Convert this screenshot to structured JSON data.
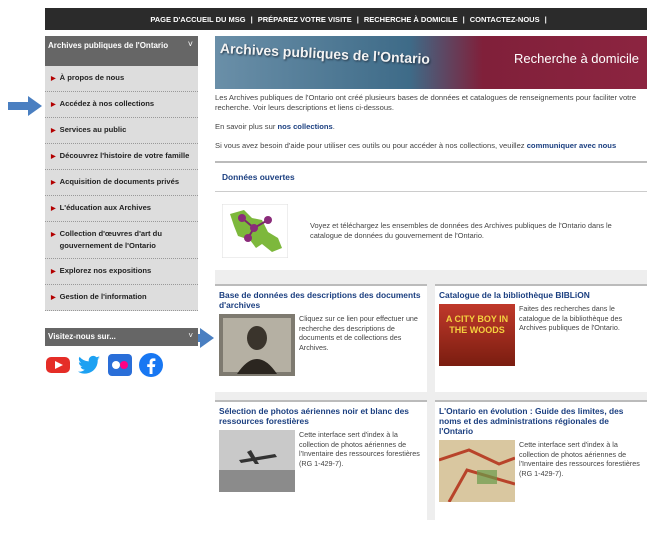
{
  "topnav": {
    "items": [
      "PAGE D'ACCUEIL DU MSG",
      "PRÉPAREZ VOTRE VISITE",
      "RECHERCHE À DOMICILE",
      "CONTACTEZ-NOUS"
    ],
    "sep": "|"
  },
  "sidebar": {
    "title": "Archives publiques de l'Ontario",
    "chevron": "˅",
    "items": [
      {
        "label": "À propos de nous"
      },
      {
        "label": "Accédez à nos collections"
      },
      {
        "label": "Services au public"
      },
      {
        "label": "Découvrez l'histoire de votre famille"
      },
      {
        "label": "Acquisition de documents privés"
      },
      {
        "label": "L'éducation aux Archives"
      },
      {
        "label": "Collection d'œuvres d'art du gouvernement de l'Ontario"
      },
      {
        "label": "Explorez nos expositions"
      },
      {
        "label": "Gestion de l'information"
      }
    ],
    "visit_title": "Visitez-nous sur...",
    "social": [
      "youtube-icon",
      "twitter-icon",
      "flickr-icon",
      "facebook-icon"
    ]
  },
  "banner": {
    "left_text": "Archives publiques de l'Ontario",
    "right_text": "Recherche à domicile"
  },
  "intro": {
    "p1": "Les Archives publiques de l'Ontario ont créé plusieurs bases de données et catalogues de renseignements pour faciliter votre recherche. Voir leurs descriptions et liens ci-dessous.",
    "p2_prefix": "En savoir plus sur ",
    "p2_link": "nos collections",
    "p2_suffix": ".",
    "p3_prefix": "Si vous avez besoin d'aide pour utiliser ces outils ou pour accéder à nos collections, veuillez ",
    "p3_link": "communiquer avec nous"
  },
  "open_data": {
    "title": "Données ouvertes",
    "text": "Voyez et téléchargez les ensembles de données des Archives publiques de l'Ontario dans le catalogue de données du gouvernement de l'Ontario."
  },
  "cards": [
    {
      "title": "Base de données des descriptions des documents d'archives",
      "text": "Cliquez sur ce lien pour effectuer une recherche des descriptions de documents et de collections des Archives."
    },
    {
      "title": "Catalogue de la bibliothèque BIBLiON",
      "text": "Faites des recherches dans le catalogue de la bibliothèque des Archives publiques de l'Ontario.",
      "thumb_text": "A CITY BOY IN THE WOODS"
    },
    {
      "title": "Sélection de photos aériennes noir et blanc des ressources forestières",
      "text": "Cette interface sert d'index à la collection de photos aériennes de l'Inventaire des ressources forestières (RG 1-429-7)."
    },
    {
      "title": "L'Ontario en évolution : Guide des limites, des noms et des administrations régionales de l'Ontario",
      "text": "Cette interface sert d'index à la collection de photos aériennes de l'Inventaire des ressources forestières (RG 1-429-7)."
    }
  ],
  "colors": {
    "link": "#1b3f80",
    "arrow": "#4a7fc1",
    "banner_red": "#8c2440"
  }
}
